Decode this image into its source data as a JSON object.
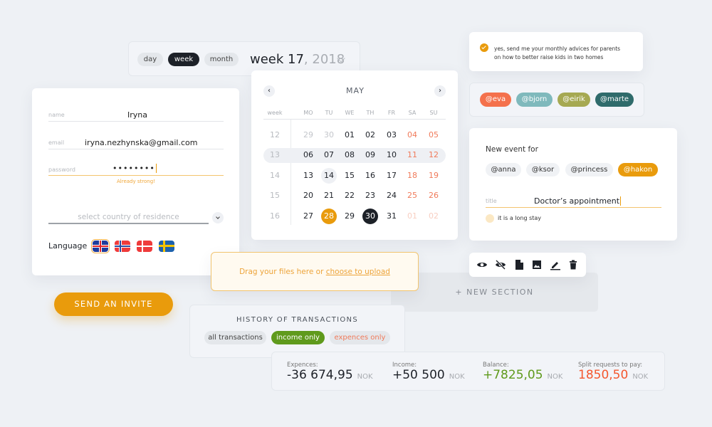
{
  "period": {
    "tabs": [
      "day",
      "week",
      "month"
    ],
    "active": "week",
    "title_bold": "week 17",
    "title_year": ", 2018"
  },
  "form": {
    "name_label": "name",
    "name_value": "Iryna",
    "email_label": "email",
    "email_value": "iryna.nezhynska@gmail.com",
    "password_label": "password",
    "password_value": "••••••••",
    "password_hint": "Already strong!",
    "country_placeholder": "select country of residence",
    "language_label": "Language",
    "flags": [
      "uk-flag",
      "norway-flag",
      "denmark-flag",
      "sweden-flag"
    ],
    "selected_flag": "uk-flag"
  },
  "invite_button": "SEND AN INVITE",
  "calendar": {
    "month": "MAY",
    "week_header": "week",
    "days": [
      "MO",
      "TU",
      "WE",
      "TH",
      "FR",
      "SA",
      "SU"
    ],
    "weeks": [
      {
        "week": "12",
        "dates": [
          "29",
          "30",
          "01",
          "02",
          "03",
          "04",
          "05"
        ]
      },
      {
        "week": "13",
        "dates": [
          "06",
          "07",
          "08",
          "09",
          "10",
          "11",
          "12"
        ]
      },
      {
        "week": "14",
        "dates": [
          "13",
          "14",
          "15",
          "16",
          "17",
          "18",
          "19"
        ]
      },
      {
        "week": "15",
        "dates": [
          "20",
          "21",
          "22",
          "23",
          "24",
          "25",
          "26"
        ]
      },
      {
        "week": "16",
        "dates": [
          "27",
          "28",
          "29",
          "30",
          "31",
          "01",
          "02"
        ]
      }
    ],
    "highlighted_week": "13",
    "today": "14",
    "selected_orange": "28",
    "selected_dark": "30"
  },
  "newsletter": {
    "checked": true,
    "text_line1": "yes, send me your monthly advices for parents",
    "text_line2": "on how to better raise kids in two homes"
  },
  "users": [
    {
      "name": "@eva",
      "color": "#f4714c"
    },
    {
      "name": "@bjorn",
      "color": "#7fb9bc"
    },
    {
      "name": "@eirik",
      "color": "#a6a952"
    },
    {
      "name": "@marte",
      "color": "#2f6b6b"
    }
  ],
  "new_event": {
    "heading": "New event for",
    "people": [
      "@anna",
      "@ksor",
      "@princess",
      "@hakon"
    ],
    "selected": "@hakon",
    "title_label": "title",
    "title_value": "Doctor’s appointment",
    "long_stay_label": "it is a long stay"
  },
  "upload": {
    "text": "Drag your files here or ",
    "link": "choose to upload"
  },
  "new_section": "+ NEW SECTION",
  "toolbar": {
    "icons": [
      "eye-icon",
      "eye-off-icon",
      "file-icon",
      "image-icon",
      "pencil-icon",
      "trash-icon"
    ]
  },
  "history": {
    "title": "HISTORY OF TRANSACTIONS",
    "filters": [
      "all transactions",
      "income only",
      "expences only"
    ],
    "active": "income only"
  },
  "summary": [
    {
      "label": "Expences:",
      "value": "-36 674,95",
      "currency": "NOK",
      "color": "#1d2128"
    },
    {
      "label": "Income:",
      "value": "+50 500",
      "currency": "NOK",
      "color": "#1d2128"
    },
    {
      "label": "Balance:",
      "value": "+7825,05",
      "currency": "NOK",
      "color": "#5f9a1c"
    },
    {
      "label": "Split requests to pay:",
      "value": "1850,50",
      "currency": "NOK",
      "color": "#f4572e"
    }
  ],
  "colors": {
    "accent": "#e99b0c",
    "dark": "#1d2128",
    "weekend": "#f07a5a",
    "green": "#5f9a1c"
  }
}
